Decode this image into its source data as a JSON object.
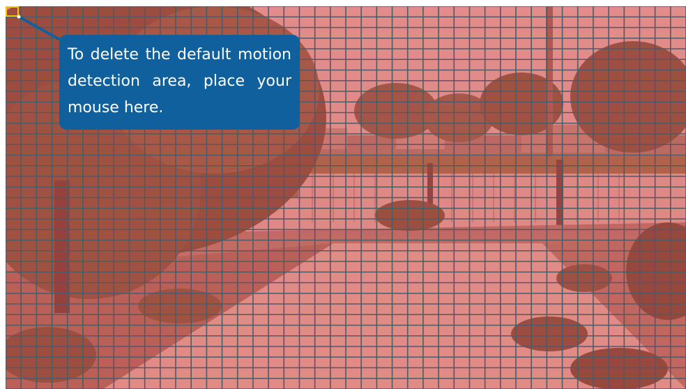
{
  "tooltip": {
    "text": "To delete the default motion detection area, place your mouse here."
  },
  "motion_grid": {
    "overlay_color": "#d9534f",
    "grid_line_color": "#4f5a64",
    "selected_cell_color": "#f5c400",
    "callout_color": "#11609e"
  }
}
